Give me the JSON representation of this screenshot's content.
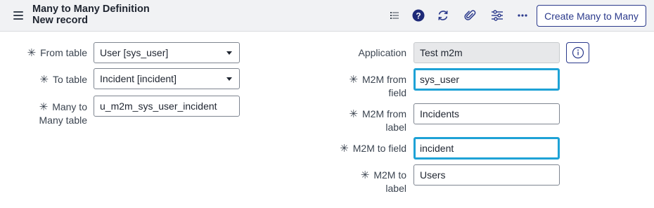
{
  "header": {
    "title": "Many to Many Definition",
    "subtitle": "New record",
    "primary_button": "Create Many to Many",
    "icons": [
      "hamburger-icon",
      "list-icon",
      "help-icon",
      "refresh-icon",
      "attachment-icon",
      "settings-sliders-icon",
      "more-icon"
    ]
  },
  "left": {
    "from_table": {
      "label": "From table",
      "value": "User [sys_user]"
    },
    "to_table": {
      "label": "To table",
      "value": "Incident [incident]"
    },
    "m2m_table": {
      "label_line1": "Many to",
      "label_line2": "Many table",
      "value": "u_m2m_sys_user_incident"
    }
  },
  "right": {
    "application": {
      "label": "Application",
      "value": "Test m2m"
    },
    "m2m_from_field": {
      "label_line1": "M2M from",
      "label_line2": "field",
      "value": "sys_user"
    },
    "m2m_from_label": {
      "label_line1": "M2M from",
      "label_line2": "label",
      "value": "Incidents"
    },
    "m2m_to_field": {
      "label": "M2M to field",
      "value": "incident"
    },
    "m2m_to_label": {
      "label_line1": "M2M to",
      "label_line2": "label",
      "value": "Users"
    }
  },
  "required_marker": "✳",
  "colors": {
    "accent": "#2b3a8c",
    "focus": "#1ea2d6",
    "header_bg": "#f1f2f4"
  }
}
